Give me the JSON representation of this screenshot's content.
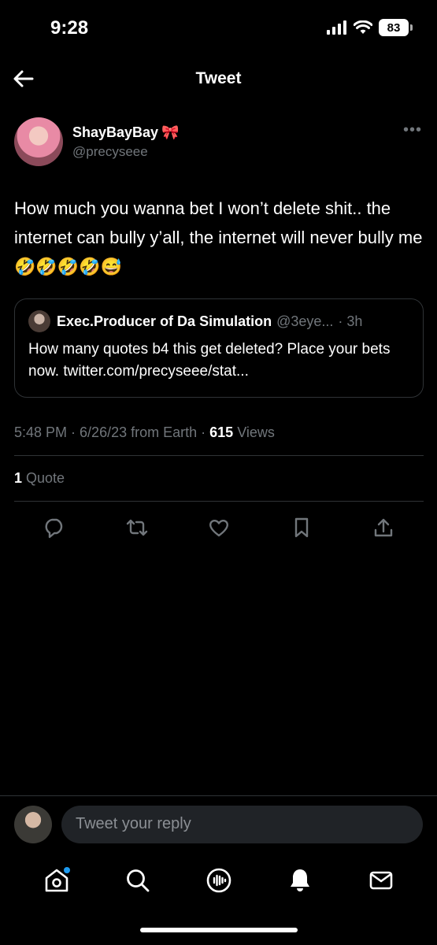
{
  "status_bar": {
    "time": "9:28",
    "battery": "83"
  },
  "header": {
    "title": "Tweet"
  },
  "tweet": {
    "display_name": "ShayBayBay",
    "name_emoji": "🎀",
    "handle": "@precyseee",
    "text": "How much you wanna bet I won’t delete shit.. the internet can bully y’all, the internet will never bully me 🤣🤣🤣🤣😅",
    "quoted": {
      "display_name": "Exec.Producer of Da Simulation",
      "handle": "@3eye...",
      "time": "· 3h",
      "text": "How many quotes b4 this get deleted? Place your bets now. twitter.com/precyseee/stat..."
    },
    "meta": {
      "time": "5:48 PM",
      "date": "6/26/23",
      "source": "from Earth",
      "views_count": "615",
      "views_label": "Views"
    },
    "quotes": {
      "count": "1",
      "label": "Quote"
    }
  },
  "reply": {
    "placeholder": "Tweet your reply"
  },
  "tabs": [
    "home-icon",
    "search-icon",
    "spaces-icon",
    "notifications-icon",
    "messages-icon"
  ],
  "colors": {
    "background": "#000000",
    "accent": "#1d9bf0",
    "muted": "#71767b",
    "divider": "#2f3336"
  }
}
